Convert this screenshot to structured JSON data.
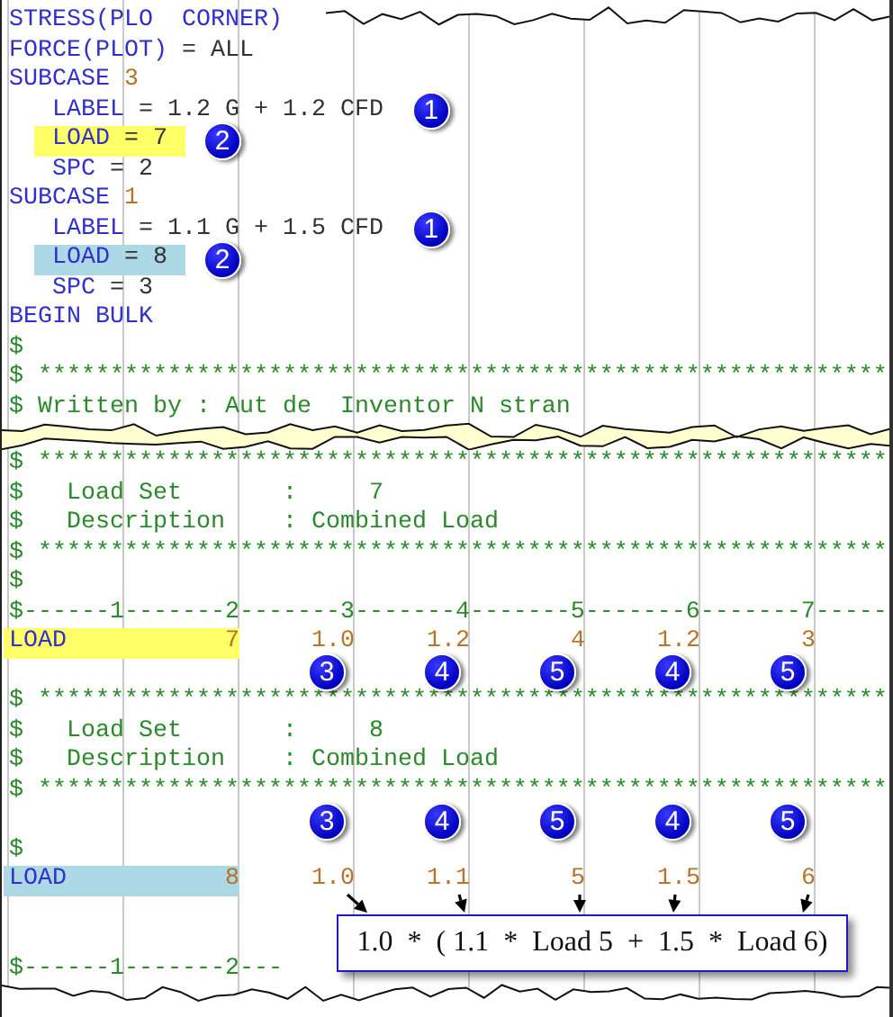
{
  "lines": [
    {
      "kind": "code",
      "indent": false,
      "tokens": [
        {
          "text": "STRESS(PLO",
          "kind": "keyword"
        },
        {
          "text": "  CORNER)",
          "kind": "keyword"
        }
      ]
    },
    {
      "kind": "code",
      "indent": false,
      "tokens": [
        {
          "text": "FORCE(PLOT)",
          "kind": "keyword"
        },
        {
          "text": " = ALL",
          "kind": "plain"
        }
      ]
    },
    {
      "kind": "code",
      "indent": false,
      "tokens": [
        {
          "text": "SUBCASE",
          "kind": "keyword"
        },
        {
          "text": " 3",
          "kind": "number"
        }
      ]
    },
    {
      "kind": "code",
      "indent": true,
      "badge": "1",
      "tokens": [
        {
          "text": "LABEL",
          "kind": "keyword"
        },
        {
          "text": " = 1.2 G + 1.2 CFD",
          "kind": "plain"
        }
      ]
    },
    {
      "kind": "code",
      "indent": true,
      "color": "#ffff66",
      "badge": "2",
      "tokens": [
        {
          "text": "LOAD",
          "kind": "keyword"
        },
        {
          "text": " = 7",
          "kind": "plain"
        }
      ]
    },
    {
      "kind": "code",
      "indent": true,
      "tokens": [
        {
          "text": "SPC",
          "kind": "keyword"
        },
        {
          "text": " = 2",
          "kind": "plain"
        }
      ]
    },
    {
      "kind": "code",
      "indent": false,
      "tokens": [
        {
          "text": "SUBCASE",
          "kind": "keyword"
        },
        {
          "text": " 1",
          "kind": "number"
        }
      ]
    },
    {
      "kind": "code",
      "indent": true,
      "badge": "1",
      "tokens": [
        {
          "text": "LABEL",
          "kind": "keyword"
        },
        {
          "text": " = 1.1 G + 1.5 CFD",
          "kind": "plain"
        }
      ]
    },
    {
      "kind": "code",
      "indent": true,
      "color": "#add8e6",
      "badge": "2",
      "tokens": [
        {
          "text": "LOAD",
          "kind": "keyword"
        },
        {
          "text": " = 8",
          "kind": "plain"
        }
      ]
    },
    {
      "kind": "code",
      "indent": true,
      "tokens": [
        {
          "text": "SPC",
          "kind": "keyword"
        },
        {
          "text": " = 3",
          "kind": "plain"
        }
      ]
    },
    {
      "kind": "code",
      "indent": false,
      "tokens": [
        {
          "text": "BEGIN BULK",
          "kind": "keyword"
        }
      ]
    },
    {
      "kind": "code",
      "indent": false,
      "tokens": [
        {
          "text": "$",
          "kind": "comment"
        }
      ]
    },
    {
      "kind": "code",
      "indent": false,
      "tokens": [
        {
          "text": "$ ***********************************************************",
          "kind": "comment"
        }
      ]
    },
    {
      "kind": "code",
      "indent": false,
      "tokens": [
        {
          "text": "$ Written by : Aut de  Inventor N stran",
          "kind": "comment"
        }
      ]
    },
    {
      "kind": "tear"
    },
    {
      "kind": "code",
      "indent": false,
      "tokens": [
        {
          "text": "$ ***********************************************************",
          "kind": "comment"
        }
      ]
    },
    {
      "kind": "code",
      "indent": false,
      "tokens": [
        {
          "text": "$   Load Set       :     7",
          "kind": "comment"
        }
      ]
    },
    {
      "kind": "code",
      "indent": false,
      "tokens": [
        {
          "text": "$   Description    : Combined Load",
          "kind": "comment"
        }
      ]
    },
    {
      "kind": "code",
      "indent": false,
      "tokens": [
        {
          "text": "$ ***********************************************************",
          "kind": "comment"
        }
      ]
    },
    {
      "kind": "code",
      "indent": false,
      "tokens": [
        {
          "text": "$",
          "kind": "comment"
        }
      ]
    },
    {
      "kind": "code",
      "indent": false,
      "tokens": [
        {
          "text": "$------1-------2-------3-------4-------5-------6-------7-----",
          "kind": "comment"
        }
      ]
    },
    {
      "kind": "fields",
      "color": "#ffff66",
      "fields": [
        {
          "text": "LOAD",
          "kind": "keyword",
          "highlighted": true
        },
        {
          "text": "7",
          "kind": "number",
          "highlighted": true
        },
        {
          "text": "1.0",
          "kind": "number",
          "highlighted": false
        },
        {
          "text": "1.2",
          "kind": "number",
          "highlighted": false
        },
        {
          "text": "4",
          "kind": "number",
          "highlighted": false
        },
        {
          "text": "1.2",
          "kind": "number",
          "highlighted": false
        },
        {
          "text": "3",
          "kind": "number",
          "highlighted": false
        }
      ]
    },
    {
      "kind": "badges",
      "badges": [
        "3",
        "4",
        "5",
        "4",
        "5"
      ]
    },
    {
      "kind": "code",
      "indent": false,
      "tokens": [
        {
          "text": "$ ***********************************************************",
          "kind": "comment"
        }
      ]
    },
    {
      "kind": "code",
      "indent": false,
      "tokens": [
        {
          "text": "$   Load Set       :     8",
          "kind": "comment"
        }
      ]
    },
    {
      "kind": "code",
      "indent": false,
      "tokens": [
        {
          "text": "$   Description    : Combined Load",
          "kind": "comment"
        }
      ]
    },
    {
      "kind": "code",
      "indent": false,
      "tokens": [
        {
          "text": "$ ***********************************************************",
          "kind": "comment"
        }
      ]
    },
    {
      "kind": "badges",
      "badges": [
        "3",
        "4",
        "5",
        "4",
        "5"
      ]
    },
    {
      "kind": "code",
      "indent": false,
      "tokens": [
        {
          "text": "$",
          "kind": "comment"
        }
      ]
    },
    {
      "kind": "fields",
      "color": "#add8e6",
      "fields": [
        {
          "text": "LOAD",
          "kind": "keyword",
          "highlighted": true
        },
        {
          "text": "8",
          "kind": "number",
          "highlighted": true
        },
        {
          "text": "1.0",
          "kind": "number",
          "highlighted": false
        },
        {
          "text": "1.1",
          "kind": "number",
          "highlighted": false
        },
        {
          "text": "5",
          "kind": "number",
          "highlighted": false
        },
        {
          "text": "1.5",
          "kind": "number",
          "highlighted": false
        },
        {
          "text": "6",
          "kind": "number",
          "highlighted": false
        }
      ]
    },
    {
      "kind": "blank"
    },
    {
      "kind": "blank"
    },
    {
      "kind": "code",
      "indent": false,
      "tokens": [
        {
          "text": "$------1-------2---",
          "kind": "comment"
        }
      ]
    }
  ],
  "callout": {
    "text": "1.0  *  ( 1.1  *  Load 5  +  1.5  *  Load 6)"
  }
}
